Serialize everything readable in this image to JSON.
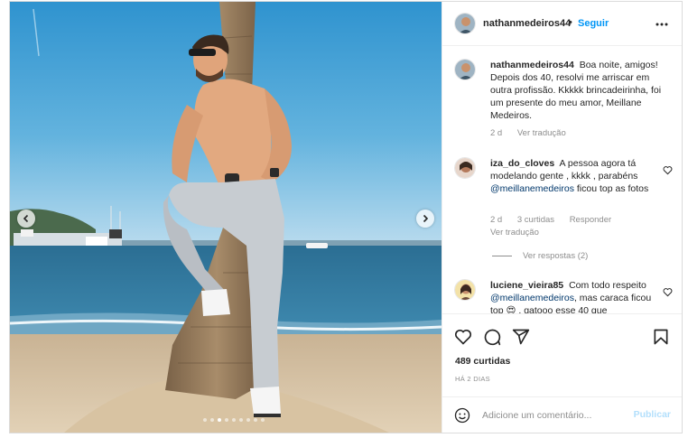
{
  "post": {
    "username": "nathanmedeiros44",
    "separator": "•",
    "follow_label": "Seguir",
    "more_icon": "more-horizontal-icon"
  },
  "caption": {
    "username": "nathanmedeiros44",
    "text": "Boa noite, amigos! Depois dos 40, resolvi me arriscar em outra profissão. Kkkkk brincadeirinha, foi um presente do meu amor, Meillane Medeiros.",
    "age": "2 d",
    "translate": "Ver tradução"
  },
  "comments": [
    {
      "username": "iza_do_cloves",
      "text_before": "A pessoa agora tá modelando gente , kkkk , parabéns",
      "mention": "@meillanemedeiros",
      "text_after": "ficou top as fotos",
      "age": "2 d",
      "likes": "3 curtidas",
      "reply": "Responder",
      "translate": "Ver tradução",
      "view_replies": "Ver respostas (2)"
    },
    {
      "username": "luciene_vieira85",
      "text_before": "Com todo respeito",
      "mention": "@meillanemedeiros",
      "text_after": ", mas caraca ficou top 😍 , gatooo esse 40 que"
    }
  ],
  "stats": {
    "likes": "489 curtidas",
    "time": "HÁ 2 DIAS"
  },
  "add_comment": {
    "placeholder": "Adicione um comentário...",
    "publish_label": "Publicar"
  },
  "carousel": {
    "slide_count": 9,
    "active_index": 2
  },
  "colors": {
    "accent": "#0095f6",
    "publish_disabled": "#b2dffc",
    "muted": "#8e8e8e",
    "link": "#00376b"
  }
}
